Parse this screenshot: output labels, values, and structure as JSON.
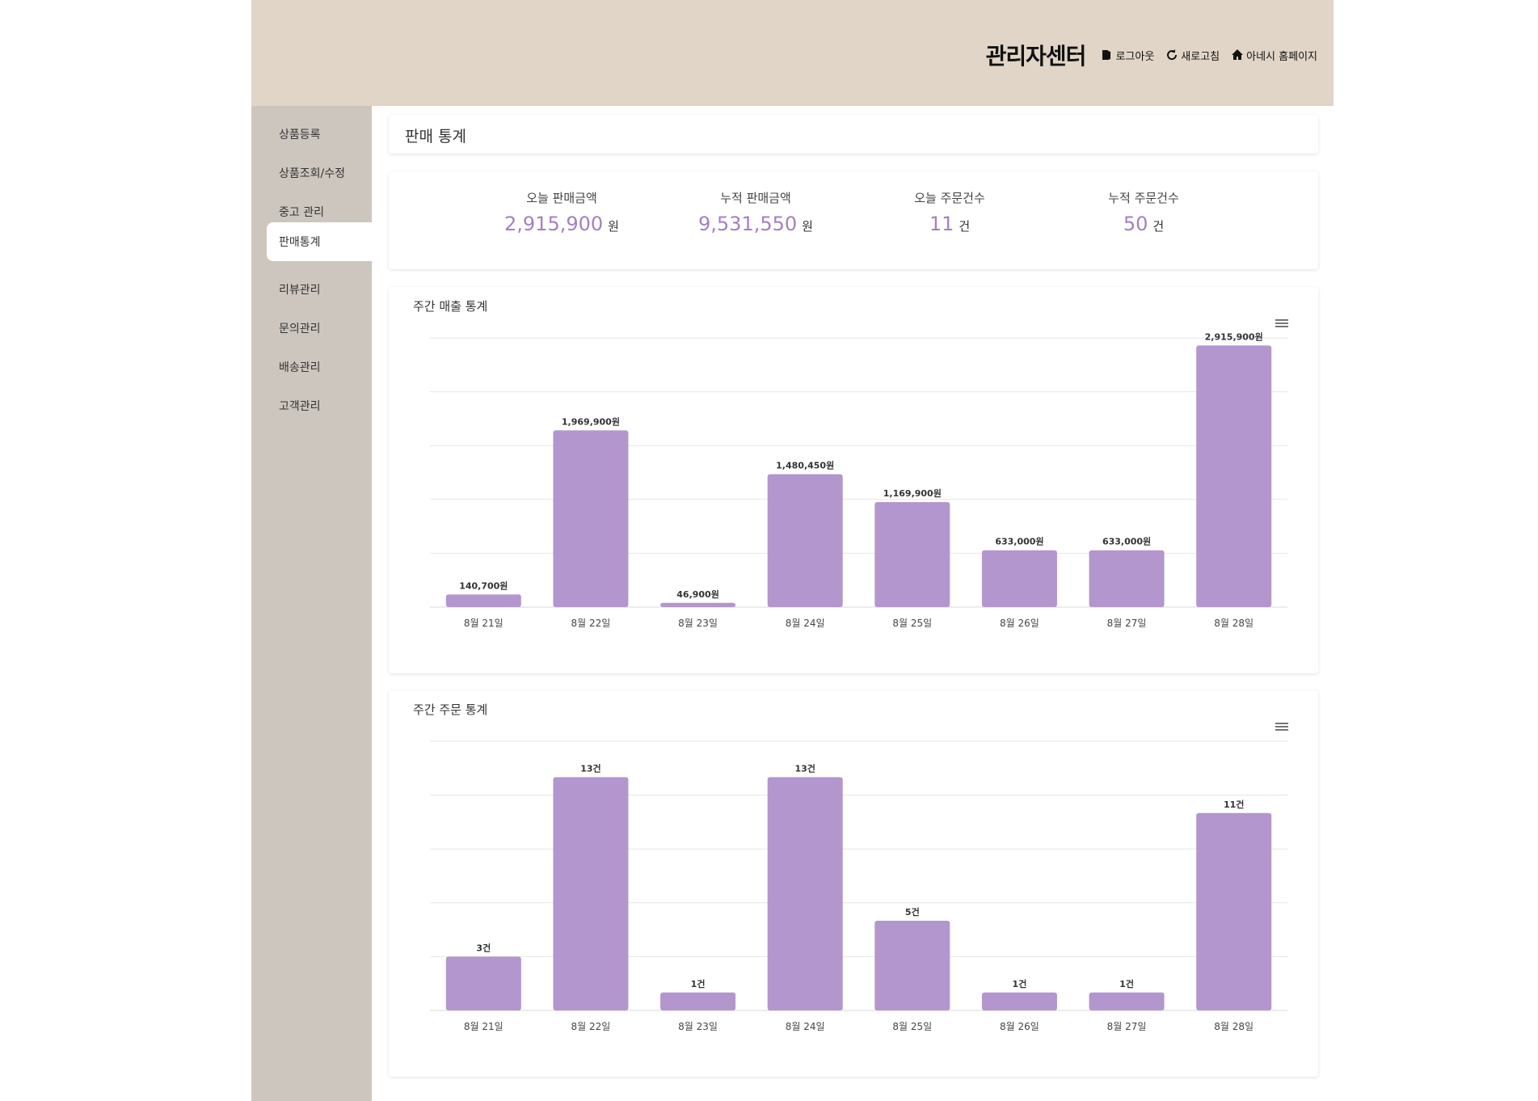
{
  "header": {
    "title": "관리자센터",
    "logout_label": "로그아웃",
    "refresh_label": "새로고침",
    "homepage_label": "아네시 홈페이지"
  },
  "sidebar": {
    "items": [
      {
        "label": "상품등록",
        "active": false
      },
      {
        "label": "상품조회/수정",
        "active": false
      },
      {
        "label": "중고 관리",
        "active": false
      },
      {
        "label": "판매통계",
        "active": true
      },
      {
        "label": "리뷰관리",
        "active": false
      },
      {
        "label": "문의관리",
        "active": false
      },
      {
        "label": "배송관리",
        "active": false
      },
      {
        "label": "고객관리",
        "active": false
      }
    ]
  },
  "page": {
    "title": "판매 통계"
  },
  "stats": [
    {
      "label": "오늘 판매금액",
      "value": "2,915,900",
      "unit": "원"
    },
    {
      "label": "누적 판매금액",
      "value": "9,531,550",
      "unit": "원"
    },
    {
      "label": "오늘 주문건수",
      "value": "11",
      "unit": "건"
    },
    {
      "label": "누적 주문건수",
      "value": "50",
      "unit": "건"
    }
  ],
  "colors": {
    "accent": "#a47fc5",
    "bar": "#b396cd",
    "header": "#e0d5c6",
    "sidebar": "#cdc6bf"
  },
  "chart_data": [
    {
      "type": "bar",
      "title": "주간 매출 통계",
      "categories": [
        "8월 21일",
        "8월 22일",
        "8월 23일",
        "8월 24일",
        "8월 25일",
        "8월 26일",
        "8월 27일",
        "8월 28일"
      ],
      "values": [
        140700,
        1969900,
        46900,
        1480450,
        1169900,
        633000,
        633000,
        2915900
      ],
      "data_labels": [
        "140,700원",
        "1,969,900원",
        "46,900원",
        "1,480,450원",
        "1,169,900원",
        "633,000원",
        "633,000원",
        "2,915,900원"
      ],
      "ylim": [
        0,
        3000000
      ],
      "grid": true,
      "legend": "none"
    },
    {
      "type": "bar",
      "title": "주간 주문 통계",
      "categories": [
        "8월 21일",
        "8월 22일",
        "8월 23일",
        "8월 24일",
        "8월 25일",
        "8월 26일",
        "8월 27일",
        "8월 28일"
      ],
      "values": [
        3,
        13,
        1,
        13,
        5,
        1,
        1,
        11
      ],
      "data_labels": [
        "3건",
        "13건",
        "1건",
        "13건",
        "5건",
        "1건",
        "1건",
        "11건"
      ],
      "ylim": [
        0,
        15
      ],
      "grid": true,
      "legend": "none"
    }
  ]
}
